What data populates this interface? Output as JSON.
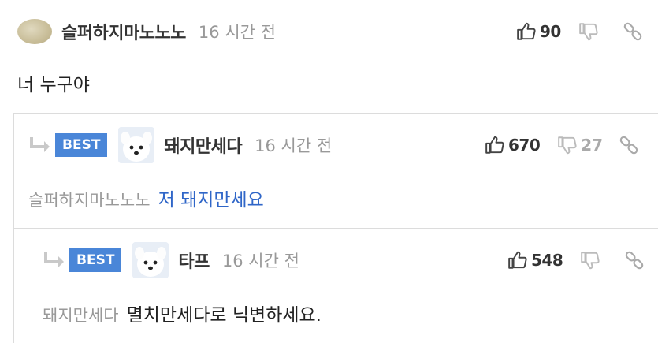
{
  "comments": [
    {
      "nickname": "슬퍼하지마노노노",
      "time": "16 시간 전",
      "likes": "90",
      "dislikes": "",
      "best": false,
      "mention": "",
      "text": "너 누구야"
    },
    {
      "nickname": "돼지만세다",
      "time": "16 시간 전",
      "likes": "670",
      "dislikes": "27",
      "best": true,
      "best_label": "BEST",
      "mention": "슬퍼하지마노노노",
      "text": "저 돼지만세요"
    },
    {
      "nickname": "타프",
      "time": "16 시간 전",
      "likes": "548",
      "dislikes": "",
      "best": true,
      "best_label": "BEST",
      "mention": "돼지만세다",
      "text": "멸치만세다로 닉변하세요."
    }
  ],
  "colors": {
    "best_badge": "#4a86d8",
    "reply_link": "#2f66c8",
    "muted": "#999999"
  },
  "icons": {
    "like": "thumbs-up-icon",
    "dislike": "thumbs-down-icon",
    "link": "link-icon",
    "reply": "reply-arrow-icon"
  }
}
